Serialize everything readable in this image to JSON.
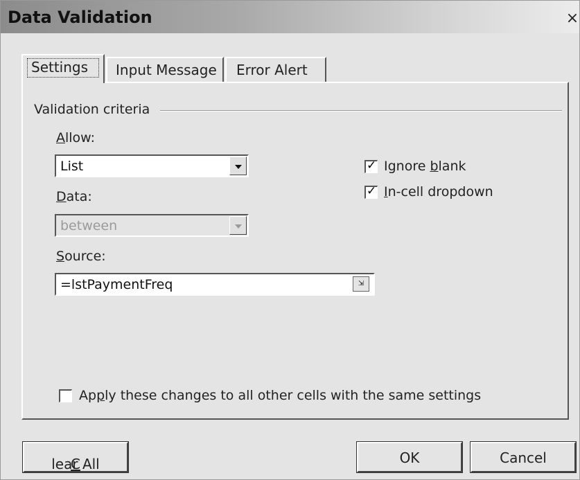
{
  "window": {
    "title": "Data Validation",
    "close_glyph": "×"
  },
  "tabs": [
    {
      "label": "Settings",
      "active": true
    },
    {
      "label": "Input Message",
      "active": false
    },
    {
      "label": "Error Alert",
      "active": false
    }
  ],
  "criteria": {
    "group_label": "Validation criteria",
    "allow": {
      "label_pre": "",
      "label_u": "A",
      "label_post": "llow:",
      "value": "List"
    },
    "data": {
      "label_pre": "",
      "label_u": "D",
      "label_post": "ata:",
      "value": "between",
      "disabled": true
    },
    "source": {
      "label_pre": "",
      "label_u": "S",
      "label_post": "ource:",
      "value": "=lstPaymentFreq"
    },
    "ignore_blank": {
      "label_pre": "Ignore ",
      "label_u": "b",
      "label_post": "lank",
      "checked": true
    },
    "in_cell_dropdown": {
      "label_pre": "",
      "label_u": "I",
      "label_post": "n-cell dropdown",
      "checked": true
    },
    "apply_all": {
      "label_pre": "Ap",
      "label_u": "p",
      "label_post": "ly these changes to all other cells with the same settings",
      "checked": false
    }
  },
  "buttons": {
    "clear_all": {
      "label_pre": "",
      "label_u": "C",
      "label_post": "lear All"
    },
    "ok": "OK",
    "cancel": "Cancel"
  },
  "icons": {
    "dropdown": "chevron-down-icon",
    "ref_picker": "range-select-icon",
    "check": "checkmark-icon"
  }
}
